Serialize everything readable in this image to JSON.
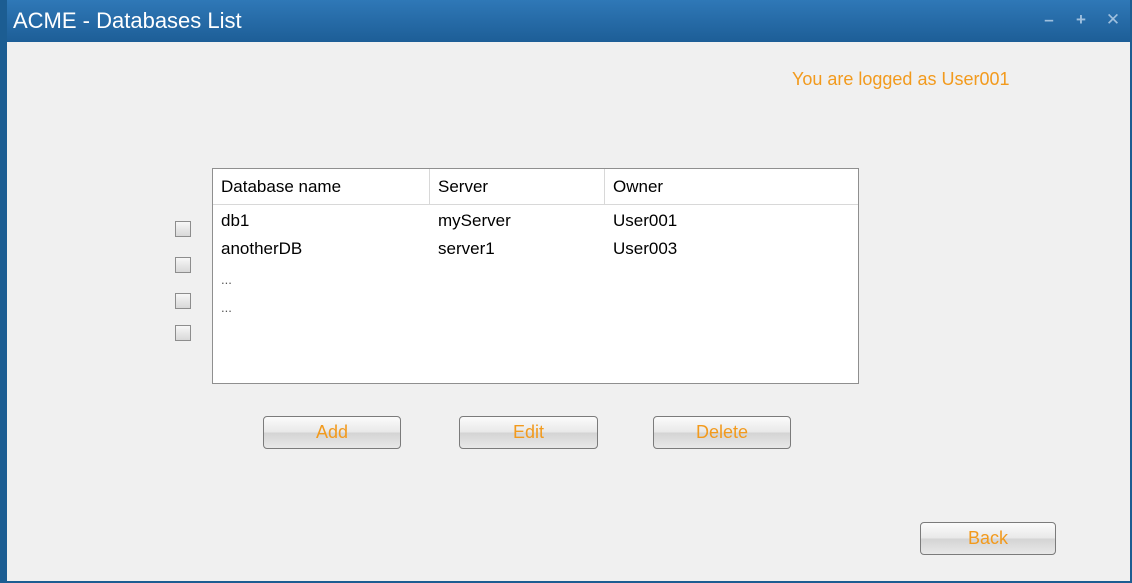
{
  "window": {
    "title": "ACME - Databases List",
    "controls": {
      "minimize": "–",
      "maximize": "+",
      "close": "✕"
    }
  },
  "login": {
    "text": "You are logged as User001"
  },
  "table": {
    "headers": [
      "Database name",
      "Server",
      "Owner"
    ],
    "rows": [
      [
        "db1",
        "myServer",
        "User001"
      ],
      [
        "anotherDB",
        "server1",
        "User003"
      ]
    ],
    "more_rows": [
      "...",
      "..."
    ]
  },
  "checkboxes": [
    false,
    false,
    false,
    false
  ],
  "buttons": {
    "add": "Add",
    "edit": "Edit",
    "delete": "Delete",
    "back": "Back"
  },
  "colors": {
    "titlebar": "#1d5e97",
    "accent_text": "#f29a1d",
    "background": "#f0f0f0"
  }
}
